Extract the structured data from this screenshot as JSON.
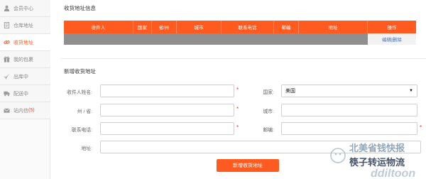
{
  "sidebar": {
    "items": [
      {
        "label": "会员中心",
        "icon": "user-icon"
      },
      {
        "label": "仓库地址",
        "icon": "document-icon"
      },
      {
        "label": "收货地址",
        "icon": "link-icon",
        "active": true
      },
      {
        "label": "我的包裹",
        "icon": "gift-icon"
      },
      {
        "label": "出库中",
        "icon": "plane-icon"
      },
      {
        "label": "配送中",
        "icon": "truck-icon"
      },
      {
        "label": "站内信",
        "count": "(5)",
        "icon": "envelope-icon"
      }
    ]
  },
  "address_list": {
    "title": "收货地址信息",
    "columns": [
      "收件人",
      "国家",
      "省/州",
      "城市",
      "联系电话",
      "邮编",
      "地址",
      "操作"
    ],
    "row_actions": "编辑|删除"
  },
  "new_address": {
    "title": "新增收货地址",
    "name_label": "收件人姓名:",
    "country_label": "国家:",
    "country_value": "美国",
    "state_label": "州 / 省:",
    "city_label": "城市:",
    "phone_label": "联系电话:",
    "zip_label": "邮编:",
    "address_label": "地址:",
    "required_mark": "*",
    "submit_label": "新增收货地址"
  },
  "watermark": {
    "line1": "北美省钱快报",
    "line2": "筷子转运物流"
  },
  "colors": {
    "accent": "#ff5a1f",
    "link": "#4a6fb5",
    "required": "#e23b1b"
  }
}
